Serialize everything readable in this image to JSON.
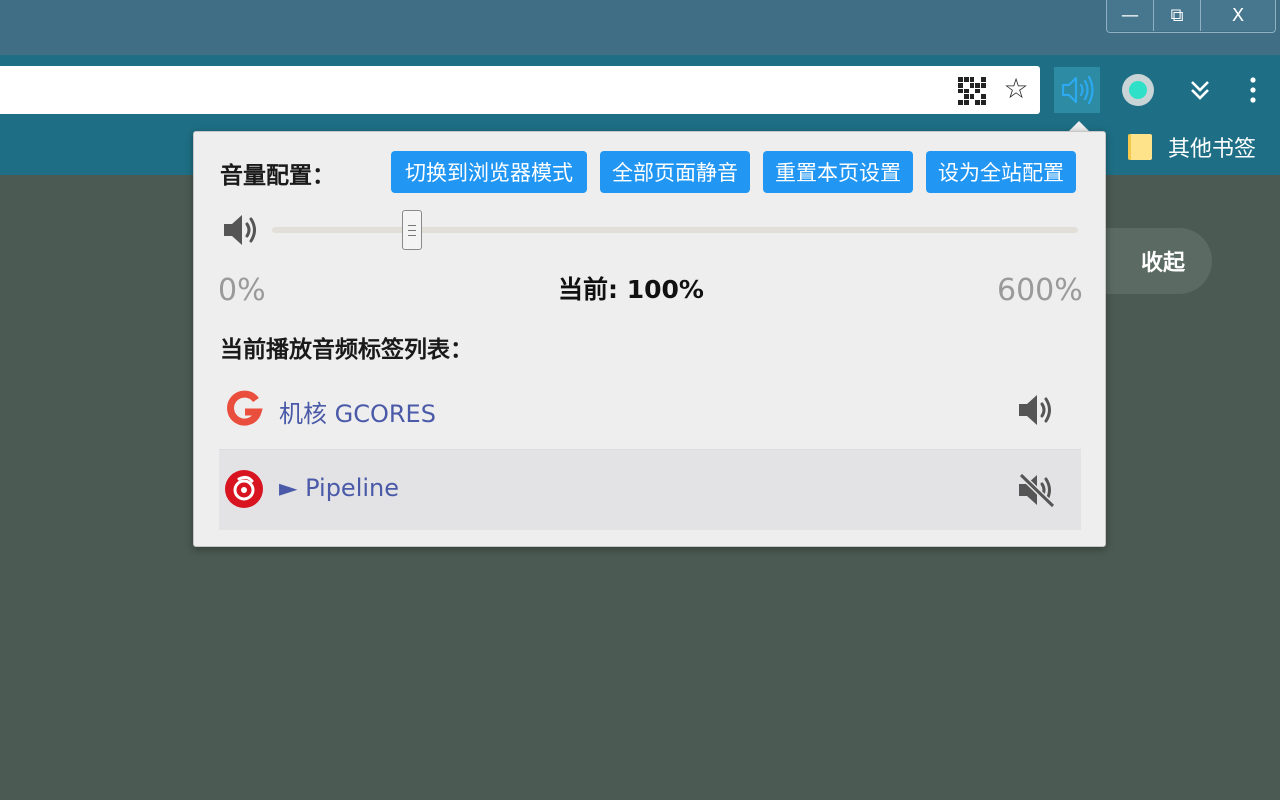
{
  "window_controls": {
    "minimize": "—",
    "restore": "⧉",
    "close": "X"
  },
  "bookmarks": {
    "other_label": "其他书签"
  },
  "page": {
    "collapse_label": "收起"
  },
  "popup": {
    "volume_title": "音量配置：",
    "buttons": {
      "browser_mode": "切换到浏览器模式",
      "mute_all": "全部页面静音",
      "reset_page": "重置本页设置",
      "set_site": "设为全站配置"
    },
    "slider": {
      "min_label": "0%",
      "max_label": "600%",
      "current_label": "当前: 100%",
      "value_percent": 100
    },
    "tabs_title": "当前播放音频标签列表：",
    "tabs": [
      {
        "title": "机核 GCORES",
        "favicon": "gcores-logo-icon",
        "state": "playing"
      },
      {
        "title": "► Pipeline",
        "favicon": "netease-music-logo-icon",
        "state": "muted"
      }
    ]
  },
  "colors": {
    "accent": "#2196f3",
    "titlebar": "#3f6e85",
    "toolbar": "#1e6f85",
    "page_bg": "#4b5a53",
    "link": "#4a5aa8"
  }
}
